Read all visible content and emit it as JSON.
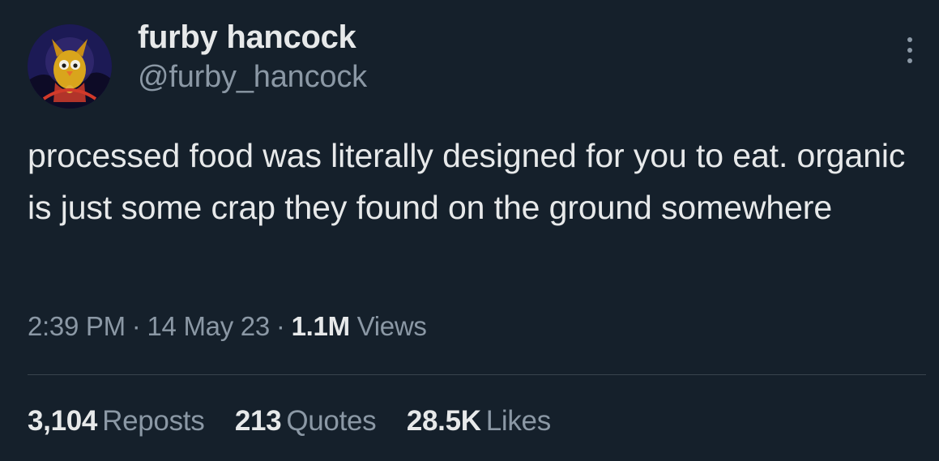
{
  "colors": {
    "background": "#15202b",
    "primary_text": "#e7e9ea",
    "secondary_text": "#8b98a5",
    "divider": "#38444d"
  },
  "author": {
    "display_name": "furby hancock",
    "handle": "@furby_hancock",
    "avatar_icon": "furby-avatar-icon"
  },
  "more_icon": "more-vertical-icon",
  "tweet": {
    "text": "processed food was literally designed for you to eat. organic is just some crap they found on the ground somewhere"
  },
  "meta": {
    "time": "2:39 PM",
    "separator": "·",
    "date": "14 May 23",
    "views_count": "1.1M",
    "views_label": "Views"
  },
  "stats": {
    "reposts_count": "3,104",
    "reposts_label": "Reposts",
    "quotes_count": "213",
    "quotes_label": "Quotes",
    "likes_count": "28.5K",
    "likes_label": "Likes"
  }
}
